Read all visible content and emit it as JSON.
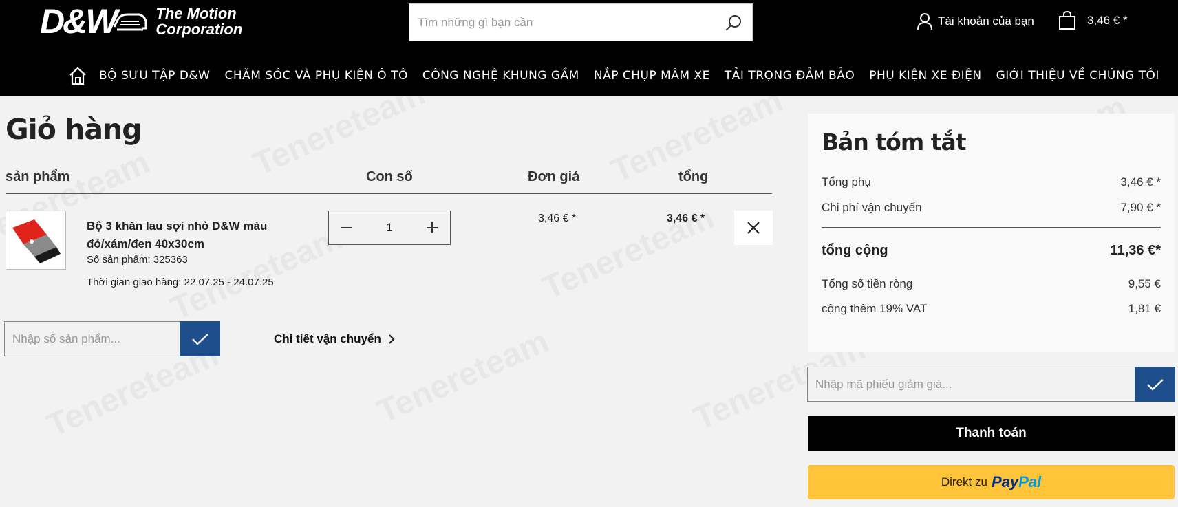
{
  "header": {
    "logo_main": "D&W",
    "logo_line1": "The Motion",
    "logo_line2": "Corporation",
    "search_placeholder": "Tìm những gì bạn cần",
    "account_label": "Tài khoản của bạn",
    "cart_total": "3,46 € *"
  },
  "nav": {
    "items": [
      "BỘ SƯU TẬP D&W",
      "CHĂM SÓC VÀ PHỤ KIỆN Ô TÔ",
      "CÔNG NGHỆ KHUNG GẦM",
      "NẮP CHỤP MÂM XE",
      "TẢI TRỌNG ĐẢM BẢO",
      "PHỤ KIỆN XE ĐIỆN",
      "GIỚI THIỆU VỀ CHÚNG TÔI"
    ]
  },
  "cart": {
    "title": "Giỏ hàng",
    "columns": {
      "product": "sản phẩm",
      "quantity": "Con số",
      "unit_price": "Đơn giá",
      "total": "tổng"
    },
    "items": [
      {
        "name": "Bộ 3 khăn lau sợi nhỏ D&W màu đỏ/xám/đen 40x30cm",
        "product_number": "Số sản phẩm: 325363",
        "delivery": "Thời gian giao hàng: 22.07.25 - 24.07.25",
        "quantity": "1",
        "unit_price": "3,46 € *",
        "total": "3,46 € *"
      }
    ],
    "product_number_placeholder": "Nhập số sản phẩm...",
    "shipping_link": "Chi tiết vận chuyển"
  },
  "summary": {
    "title": "Bản tóm tắt",
    "subtotal_label": "Tổng phụ",
    "subtotal_value": "3,46 € *",
    "shipping_label": "Chi phí vận chuyển",
    "shipping_value": "7,90 € *",
    "grand_label": "tổng cộng",
    "grand_value": "11,36 €*",
    "net_label": "Tổng số tiền ròng",
    "net_value": "9,55 €",
    "vat_label": "cộng thêm 19% VAT",
    "vat_value": "1,81 €"
  },
  "voucher_placeholder": "Nhập mã phiếu giảm giá...",
  "checkout_label": "Thanh toán",
  "paypal": {
    "prefix": "Direkt zu",
    "brand_pay": "Pay",
    "brand_pal": "Pal"
  },
  "watermark": "Tenereteam",
  "colors": {
    "header_bg": "#000000",
    "accent_blue": "#1e4e8c",
    "paypal_yellow": "#ffc439",
    "page_bg": "#f2f2f2"
  }
}
